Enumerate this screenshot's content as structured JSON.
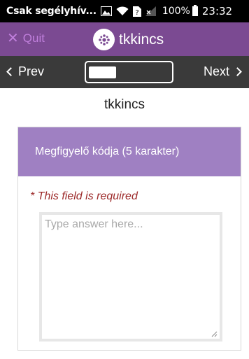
{
  "status_bar": {
    "carrier": "Csak segélyhív...",
    "battery_text": "100%",
    "time": "23:32",
    "icons": [
      "image-icon",
      "wifi-icon",
      "sim-unknown-icon",
      "no-signal-icon",
      "battery-icon"
    ]
  },
  "app_bar": {
    "quit_label": "Quit",
    "title": "tkkincs",
    "colors": {
      "background": "#7b4a92",
      "quit_text": "#c07fdc"
    }
  },
  "nav": {
    "prev_label": "Prev",
    "next_label": "Next",
    "progress_fraction": 0.33,
    "background": "#3a3a3a"
  },
  "form": {
    "name": "tkkincs",
    "question": {
      "label": "Megfigyelő kódja (5 karakter)",
      "required_text": "* This field is required",
      "answer_value": "",
      "answer_placeholder": "Type answer here...",
      "header_color": "#9f80c2",
      "required_color": "#9d2b2b"
    }
  }
}
